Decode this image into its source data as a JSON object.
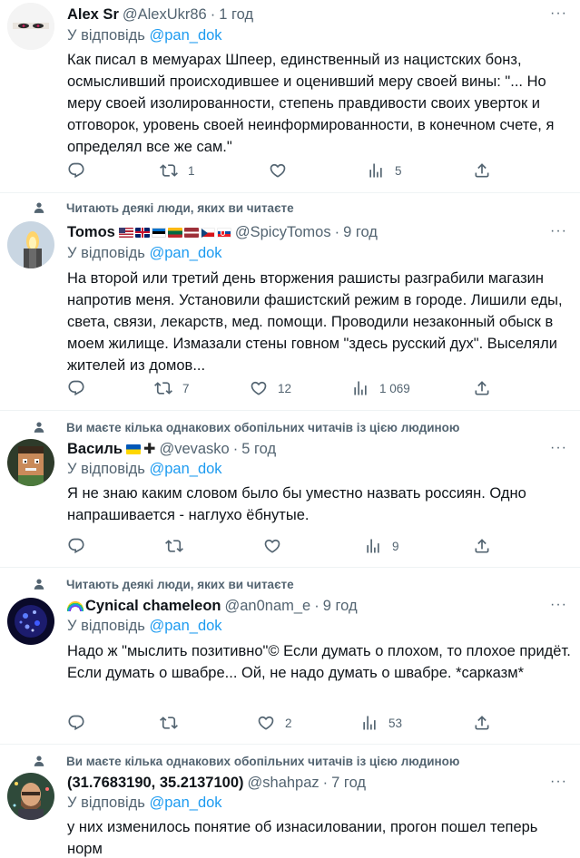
{
  "reply_prefix": "У відповідь",
  "tweets": [
    {
      "name": "Alex Sr",
      "handle": "@AlexUkr86",
      "time": "1 год",
      "mention": "@pan_dok",
      "text": "Как писал в мемуарах Шпеер, единственный из нацистских бонз, осмысливший происходившее и оценивший меру своей вины: \"... Но меру своей изолированности, степень правдивости своих уверток и отговорок, уровень своей неинформированности, в конечном счете, я определял все же сам.\"",
      "counts": {
        "reply": "",
        "retweet": "1",
        "like": "",
        "views": "5"
      }
    },
    {
      "context": "Читають деякі люди, яких ви читаєте",
      "name": "Tomos",
      "flags": [
        "us",
        "uk",
        "ee",
        "lt",
        "lv",
        "cz",
        "sk"
      ],
      "handle": "@SpicyTomos",
      "time": "9 год",
      "mention": "@pan_dok",
      "text": "На второй или третий день вторжения рашисты разграбили магазин напротив меня. Установили фашистский режим в городе. Лишили еды, света, связи, лекарств, мед. помощи. Проводили незаконный обыск в моем жилище. Измазали стены говном \"здесь русский дух\". Выселяли жителей из домов...",
      "counts": {
        "reply": "",
        "retweet": "7",
        "like": "12",
        "views": "1 069"
      }
    },
    {
      "context": "Ви маєте кілька однакових обопільних читачів із цією людиною",
      "name": "Василь",
      "flags": [
        "ua"
      ],
      "cross": "✚",
      "handle": "@vevasko",
      "time": "5 год",
      "mention": "@pan_dok",
      "text": "Я не знаю каким словом было бы уместно назвать россиян. Одно напрашивается - наглухо ёбнутые.",
      "counts": {
        "reply": "",
        "retweet": "",
        "like": "",
        "views": "9"
      }
    },
    {
      "context": "Читають деякі люди, яких ви читаєте",
      "name": "Cynical chameleon",
      "handle": "@an0nam_e",
      "time": "9 год",
      "mention": "@pan_dok",
      "text": "Надо ж \"мыслить позитивно\"© Если думать о плохом, то плохое придёт. Если думать о швабре... Ой, не надо думать о швабре. *сарказм*",
      "counts": {
        "reply": "",
        "retweet": "",
        "like": "2",
        "views": "53"
      }
    },
    {
      "context": "Ви маєте кілька однакових обопільних читачів із цією людиною",
      "name": "(31.7683190, 35.2137100)",
      "handle": "@shahpaz",
      "time": "7 год",
      "mention": "@pan_dok",
      "text": "у них изменилось понятие об изнасиловании, прогон пошел теперь норм"
    }
  ],
  "colors": {
    "text": "#0f1419",
    "secondary": "#536471",
    "link": "#1d9bf0",
    "divider": "#eff3f4"
  }
}
